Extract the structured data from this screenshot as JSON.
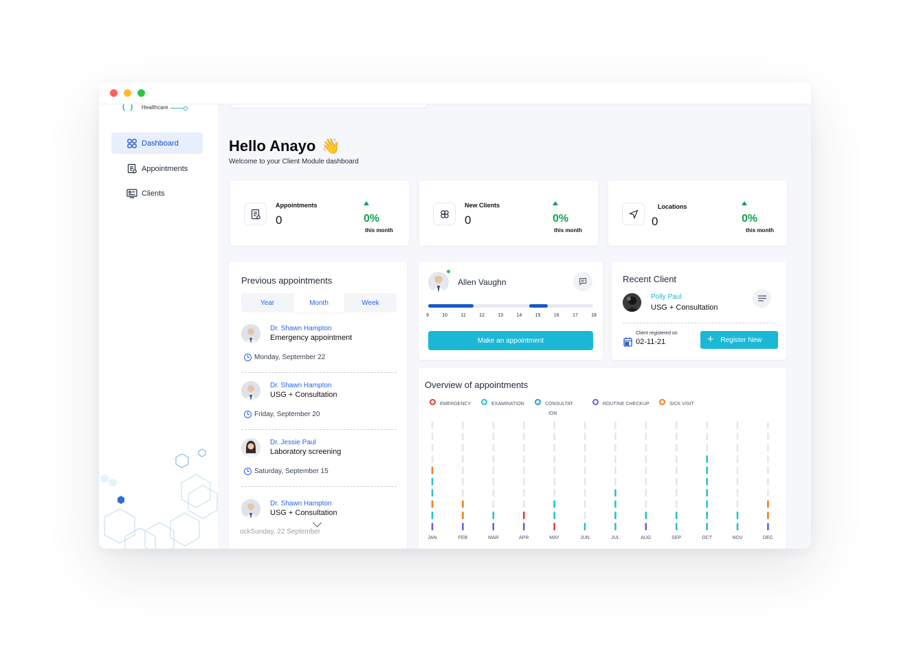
{
  "brand": {
    "sub": "Healthcare"
  },
  "sidebar": {
    "items": [
      {
        "label": "Dashboard",
        "icon": "grid-icon"
      },
      {
        "label": "Appointments",
        "icon": "clipboard-icon"
      },
      {
        "label": "Clients",
        "icon": "monitor-users-icon"
      }
    ]
  },
  "header": {
    "greeting": "Hello Anayo",
    "wave": "👋",
    "subtitle": "Welcome to your Client Module dashboard"
  },
  "stats": [
    {
      "label": "Appointments",
      "value": "0",
      "change": "0%",
      "period": "this month",
      "icon": "clipboard-icon"
    },
    {
      "label": "New Clients",
      "value": "0",
      "change": "0%",
      "period": "this month",
      "icon": "clover-icon"
    },
    {
      "label": "Locations",
      "value": "0",
      "change": "0%",
      "period": "this month",
      "icon": "navigation-icon"
    }
  ],
  "previous": {
    "title": "Previous appointments",
    "tabs": [
      "Year",
      "Month",
      "Week"
    ],
    "selected_tab": "Month",
    "items": [
      {
        "doctor": "Dr. Shawn Hampton",
        "type": "Emergency appointment",
        "date": "Monday, September 22"
      },
      {
        "doctor": "Dr. Shawn Hampton",
        "type": "USG + Consultation",
        "date": "Friday, September 20"
      },
      {
        "doctor": "Dr. Jessie Paul",
        "type": "Laboratory screening",
        "date": "Saturday, September 15"
      },
      {
        "doctor": "Dr. Shawn Hampton",
        "type": "USG + Consultation",
        "date": ""
      }
    ],
    "cut_text": "ockSunday, 22 September"
  },
  "doctor_card": {
    "name": "Allen Vaughn",
    "slots": [
      "9",
      "10",
      "11",
      "12",
      "13",
      "14",
      "15",
      "16",
      "17",
      "18"
    ],
    "button": "Make an appointment"
  },
  "recent_client": {
    "title": "Recent Client",
    "name": "Polly Paul",
    "type": "USG + Consultation",
    "registered_label": "Client registered on",
    "registered_date": "02-11-21",
    "button": "Register New"
  },
  "overview": {
    "title": "Overview of appointments",
    "legend": [
      {
        "label": "EMERGENCY",
        "color": "#e53935"
      },
      {
        "label": "EXAMINATION",
        "color": "#22c3c8"
      },
      {
        "label": "CONSULTAT",
        "label2": "ION",
        "color": "#1e9bd7"
      },
      {
        "label": "ROUTINE CHECKUP",
        "color": "#6b5ddb"
      },
      {
        "label": "SICK VISIT",
        "color": "#f07d1a"
      }
    ]
  },
  "chart_data": {
    "type": "bar",
    "categories": [
      "JAN",
      "FEB",
      "MAR",
      "APR",
      "MAY",
      "JUN",
      "JUL",
      "AUG",
      "SEP",
      "OCT",
      "NOV",
      "DEC"
    ],
    "segments_total": 10,
    "colors": {
      "emergency": "#e53935",
      "examination": "#22c3c8",
      "routine": "#6b5ddb",
      "sick": "#f07d1a",
      "empty": "#e3e6ec"
    },
    "stacks": [
      [
        "routine",
        "examination",
        "sick",
        "examination",
        "examination",
        "sick"
      ],
      [
        "routine",
        "sick",
        "sick"
      ],
      [
        "routine",
        "examination"
      ],
      [
        "routine",
        "emergency"
      ],
      [
        "emergency",
        "examination",
        "examination"
      ],
      [
        "examination"
      ],
      [
        "examination",
        "examination",
        "examination",
        "examination"
      ],
      [
        "routine",
        "examination"
      ],
      [
        "examination",
        "examination"
      ],
      [
        "examination",
        "examination",
        "examination",
        "examination",
        "examination",
        "examination",
        "examination"
      ],
      [
        "examination",
        "examination"
      ],
      [
        "routine",
        "sick",
        "sick"
      ]
    ]
  }
}
